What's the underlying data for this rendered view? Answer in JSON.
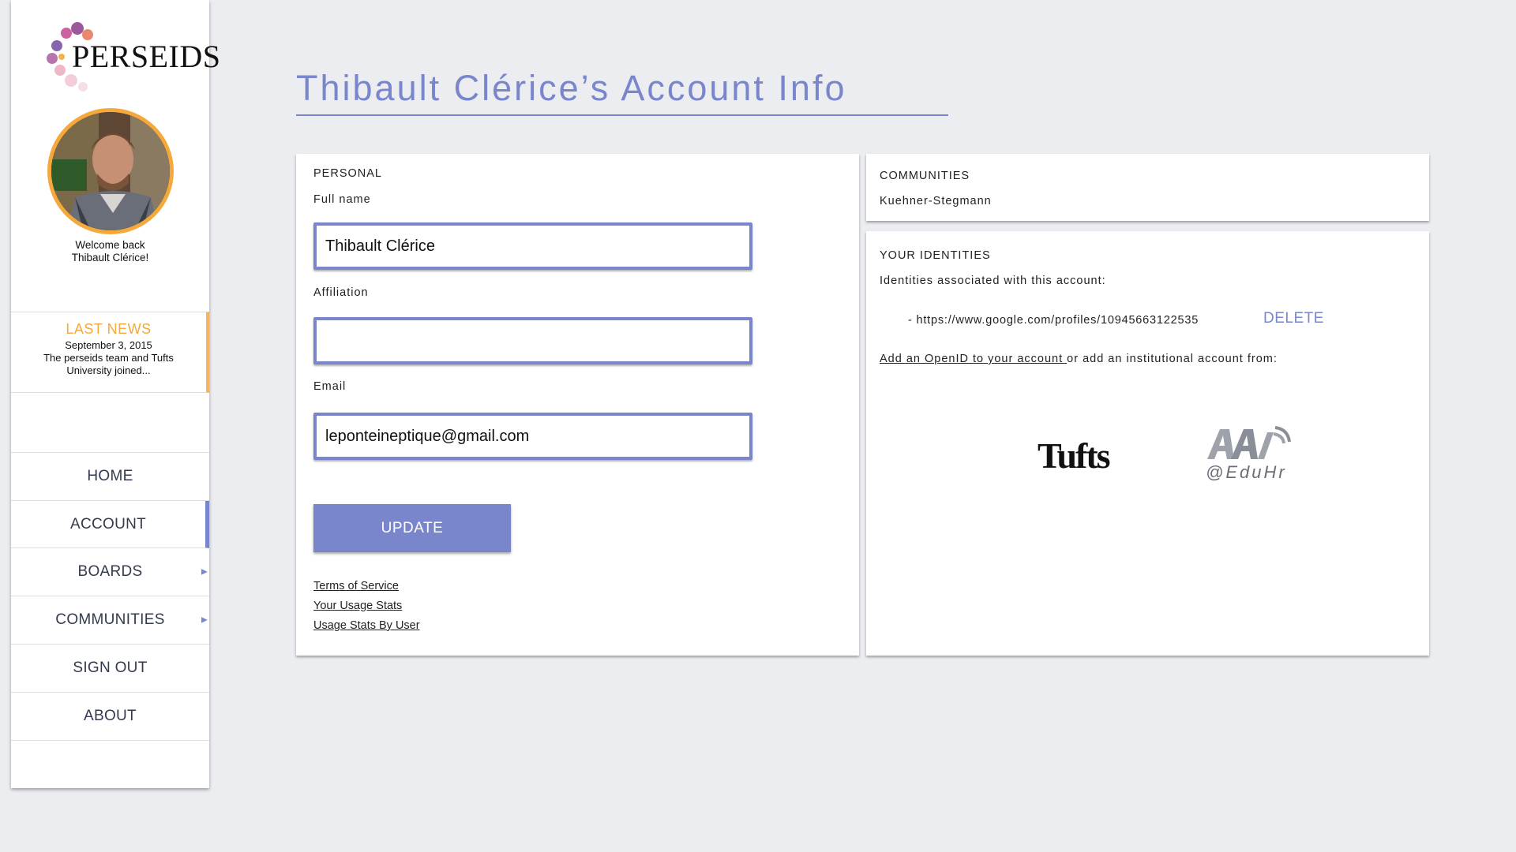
{
  "sidebar": {
    "logo_text": "PERSEIDS",
    "welcome_line1": "Welcome back",
    "welcome_line2": "Thibault Clérice!",
    "news": {
      "title": "LAST NEWS",
      "date": "September 3, 2015",
      "body": "The perseids team and Tufts University joined..."
    },
    "nav": [
      {
        "label": "HOME"
      },
      {
        "label": "ACCOUNT",
        "active": true
      },
      {
        "label": "BOARDS",
        "has_submenu": true
      },
      {
        "label": "COMMUNITIES",
        "has_submenu": true
      },
      {
        "label": "SIGN OUT"
      },
      {
        "label": "ABOUT"
      }
    ]
  },
  "page": {
    "title": "Thibault Clérice’s Account Info"
  },
  "personal": {
    "section_title": "PERSONAL",
    "full_name_label": "Full name",
    "full_name_value": "Thibault Clérice",
    "affiliation_label": "Affiliation",
    "affiliation_value": "",
    "email_label": "Email",
    "email_value": "leponteineptique@gmail.com",
    "update_label": "UPDATE",
    "links": [
      "Terms of Service",
      "Your Usage Stats",
      "Usage Stats By User"
    ]
  },
  "communities": {
    "section_title": "COMMUNITIES",
    "items": [
      "Kuehner-Stegmann"
    ]
  },
  "identities": {
    "section_title": "YOUR IDENTITIES",
    "intro": "Identities associated with this account:",
    "items": [
      {
        "url": "- https://www.google.com/profiles/10945663122535",
        "action": "DELETE"
      }
    ],
    "add_openid_link": "Add an OpenID to your account ",
    "add_rest": "or add an institutional account from:",
    "institutions": [
      "Tufts",
      "@EduHr"
    ]
  },
  "colors": {
    "accent": "#7a86cc",
    "news_orange": "#f4a93a",
    "background": "#ebedf0"
  }
}
